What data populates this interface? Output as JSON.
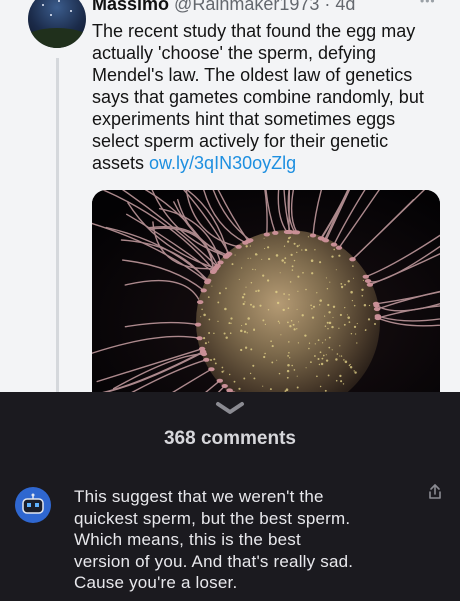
{
  "tweet": {
    "author_name": "Massimo",
    "author_handle": "@Rainmaker1973",
    "separator": " · ",
    "age": "4d",
    "more_icon": "more-dots-icon",
    "text_lines": [
      "The recent study that found the egg may",
      "actually 'choose' the sperm, defying",
      "Mendel's law. The oldest law of genetics",
      "says that gametes combine randomly, but",
      "experiments hint that sometimes eggs",
      "select sperm actively for their genetic"
    ],
    "last_line_text": "assets ",
    "link": "ow.ly/3qIN30oyZlg",
    "media_icon": "egg-and-sperm-image"
  },
  "comments": {
    "count_label": "368 comments",
    "collapse_icon": "chevron-down-icon",
    "items": [
      {
        "avatar_icon": "robot-avatar-icon",
        "text_lines": [
          "This suggest that we weren't the",
          "quickest sperm, but the best sperm.",
          "Which means, this is the best",
          "version of you. And that's really sad.",
          "Cause you're a loser."
        ],
        "share_icon": "share-icon"
      }
    ]
  },
  "colors": {
    "tweet_background": "#f3f4f6",
    "link": "#1d8fe0",
    "sheet_background": "#1b1a1f",
    "avatar_blue": "#2f67d0"
  }
}
